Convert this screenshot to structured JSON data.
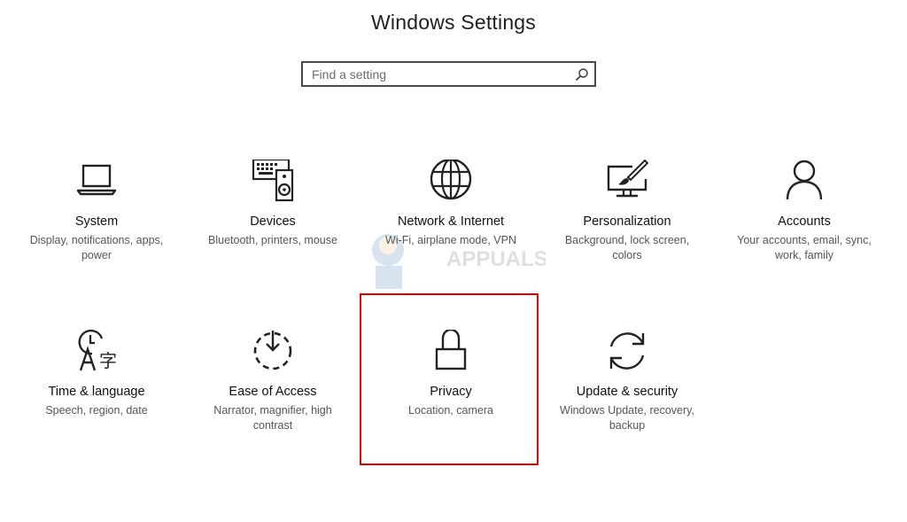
{
  "window": {
    "title": "Windows Settings"
  },
  "search": {
    "placeholder": "Find a setting",
    "icon": "search-icon"
  },
  "tiles": [
    {
      "name": "System",
      "desc": "Display, notifications, apps, power",
      "icon": "laptop-icon"
    },
    {
      "name": "Devices",
      "desc": "Bluetooth, printers, mouse",
      "icon": "devices-icon"
    },
    {
      "name": "Network & Internet",
      "desc": "Wi-Fi, airplane mode, VPN",
      "icon": "globe-icon"
    },
    {
      "name": "Personalization",
      "desc": "Background, lock screen, colors",
      "icon": "paintbrush-icon"
    },
    {
      "name": "Accounts",
      "desc": "Your accounts, email, sync, work, family",
      "icon": "person-icon"
    },
    {
      "name": "Time & language",
      "desc": "Speech, region, date",
      "icon": "time-language-icon"
    },
    {
      "name": "Ease of Access",
      "desc": "Narrator, magnifier, high contrast",
      "icon": "ease-of-access-icon"
    },
    {
      "name": "Privacy",
      "desc": "Location, camera",
      "icon": "lock-icon"
    },
    {
      "name": "Update & security",
      "desc": "Windows Update, recovery, backup",
      "icon": "sync-icon"
    }
  ],
  "highlight": {
    "color": "#e00000",
    "target": "Privacy"
  },
  "watermark": {
    "text": "APPUALS"
  }
}
